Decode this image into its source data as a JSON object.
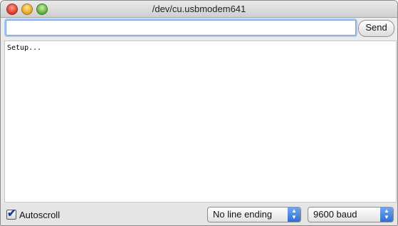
{
  "window": {
    "title": "/dev/cu.usbmodem641"
  },
  "controls": {
    "close": "close",
    "minimize": "minimize",
    "maximize": "zoom"
  },
  "input": {
    "value": "",
    "send_label": "Send"
  },
  "output": {
    "text": "Setup..."
  },
  "bottom": {
    "autoscroll_label": "Autoscroll",
    "autoscroll_checked": true,
    "line_ending_value": "No line ending",
    "baud_value": "9600 baud"
  },
  "icons": {
    "checkmark": "checkmark-icon",
    "select_arrows": "updown-arrows-icon"
  }
}
